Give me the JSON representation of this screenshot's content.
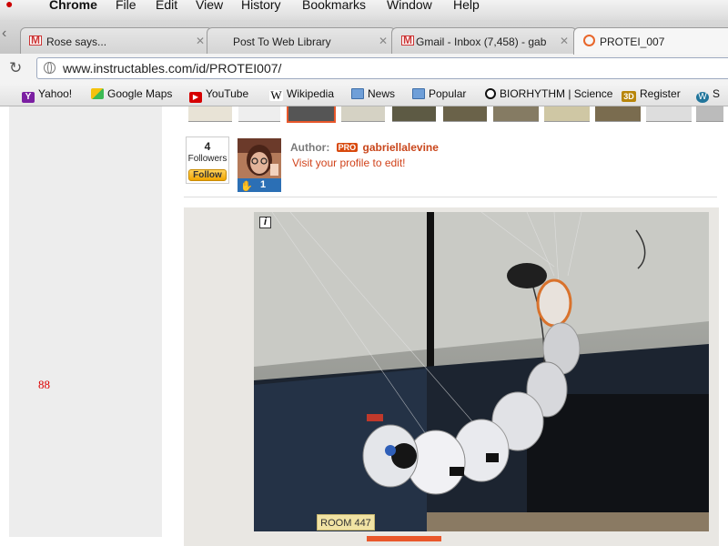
{
  "menubar": {
    "app_name": "Chrome",
    "items": [
      "File",
      "Edit",
      "View",
      "History",
      "Bookmarks",
      "Window",
      "Help"
    ]
  },
  "tabs": [
    {
      "title": "Rose says...",
      "icon": "gmail-icon"
    },
    {
      "title": "Post To Web Library",
      "icon": "page-icon"
    },
    {
      "title": "Gmail - Inbox (7,458) - gab",
      "icon": "gmail-icon"
    },
    {
      "title": "PROTEI_007",
      "icon": "instructables-icon",
      "active": true
    }
  ],
  "toolbar": {
    "url": "www.instructables.com/id/PROTEI007/"
  },
  "bookmarks": [
    {
      "label": "Yahoo!",
      "icon": "yahoo-icon"
    },
    {
      "label": "Google Maps",
      "icon": "maps-icon"
    },
    {
      "label": "YouTube",
      "icon": "youtube-icon"
    },
    {
      "label": "Wikipedia",
      "icon": "wikipedia-icon"
    },
    {
      "label": "News",
      "icon": "folder-icon"
    },
    {
      "label": "Popular",
      "icon": "folder-icon"
    },
    {
      "label": "BIORHYTHM | Science",
      "icon": "circle-icon"
    },
    {
      "label": "Register",
      "icon": "3d-icon"
    },
    {
      "label": "S",
      "icon": "wordpress-icon"
    }
  ],
  "page": {
    "page_number": "88",
    "followers": {
      "count": "4",
      "label": "Followers",
      "button": "Follow"
    },
    "avatar_patch_count": "1",
    "author_label": "Author:",
    "pro_badge": "PRO",
    "author_name": "gabriellalevine",
    "visit_link": "Visit your profile to edit!",
    "image_info": "i",
    "room_sign": "ROOM 447"
  },
  "colors": {
    "link_orange": "#d1431b",
    "pro_badge": "#d84a0e",
    "follow_button": "#f0a500"
  }
}
